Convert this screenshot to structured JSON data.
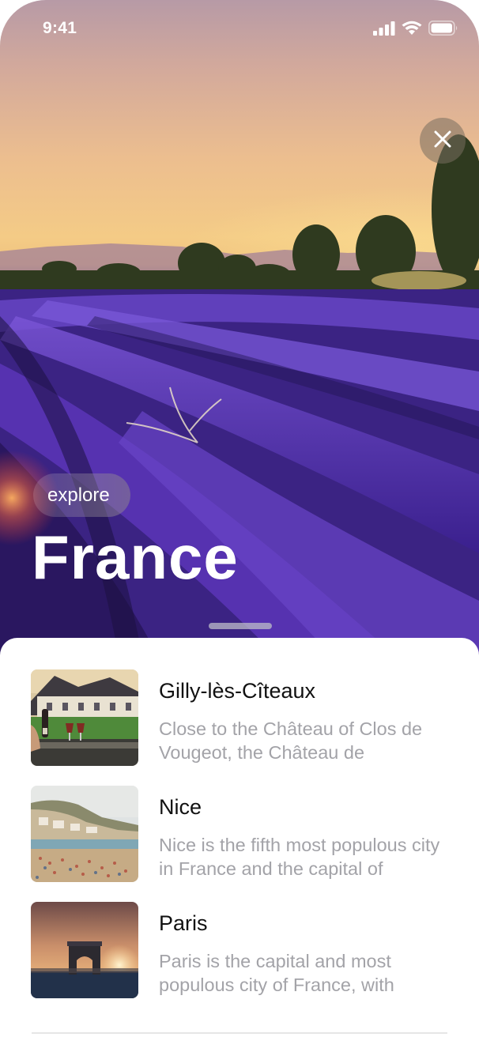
{
  "status_bar": {
    "time": "9:41",
    "icons": [
      "cellular-signal-icon",
      "wifi-icon",
      "battery-icon"
    ]
  },
  "hero": {
    "badge": "explore",
    "title": "France",
    "close_icon": "close-icon"
  },
  "places": [
    {
      "name": "Gilly-lès-Cîteaux",
      "description": "Close to the Château of Clos de Vougeot, the Château de",
      "thumbnail": "chateau-vineyard-image"
    },
    {
      "name": "Nice",
      "description": "Nice is the fifth most populous city in France and the capital of",
      "thumbnail": "nice-beach-image"
    },
    {
      "name": "Paris",
      "description": "Paris is the capital and most populous city of France, with",
      "thumbnail": "arc-de-triomphe-image"
    }
  ],
  "colors": {
    "title_text": "#ffffff",
    "place_name": "#111111",
    "place_description": "#a3a3a8",
    "lavender": "#5b35b8",
    "sunset": "#f4cb86"
  }
}
